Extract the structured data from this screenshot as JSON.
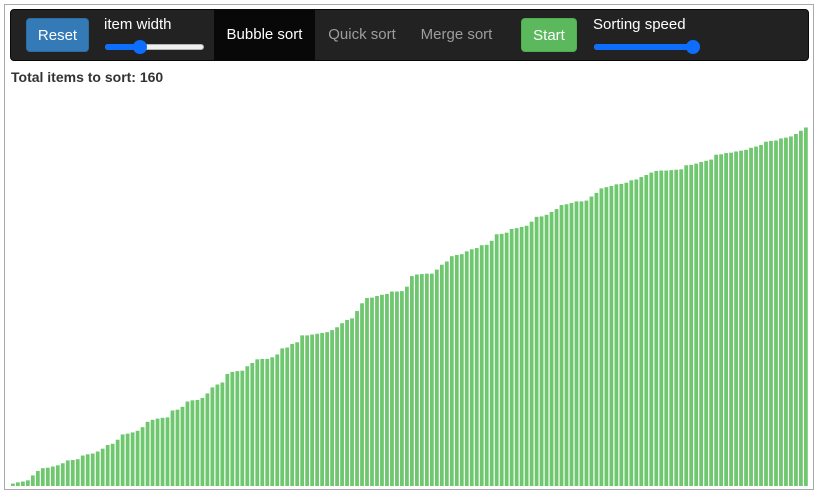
{
  "toolbar": {
    "reset_label": "Reset",
    "item_width_label": "item width",
    "item_width_value": 0.35,
    "tabs": [
      {
        "label": "Bubble sort",
        "active": true
      },
      {
        "label": "Quick sort",
        "active": false
      },
      {
        "label": "Merge sort",
        "active": false
      }
    ],
    "start_label": "Start",
    "speed_label": "Sorting speed",
    "speed_value": 1.0
  },
  "summary": {
    "label": "Total items to sort:",
    "count": "160"
  },
  "colors": {
    "navbar_bg": "#222222",
    "reset_button": "#337ab7",
    "start_button": "#5cb85c",
    "bar": "#6fc86f",
    "slider_accent": "#0d6efd"
  },
  "chart_data": {
    "type": "bar",
    "count": 160,
    "values": [
      0.6,
      0.9,
      1.1,
      1.4,
      2.6,
      3.7,
      4.4,
      4.5,
      4.8,
      5.1,
      5.6,
      6.3,
      6.4,
      6.6,
      7.5,
      7.8,
      8.0,
      8.5,
      9.2,
      10.1,
      10.4,
      11.4,
      12.7,
      12.9,
      13.2,
      13.6,
      14.5,
      15.8,
      16.3,
      16.6,
      16.8,
      16.9,
      18.6,
      18.8,
      19.5,
      20.8,
      21.1,
      21.2,
      21.7,
      22.8,
      24.3,
      25.0,
      25.5,
      27.6,
      28.1,
      28.3,
      28.4,
      29.5,
      30.3,
      31.2,
      31.3,
      31.3,
      31.7,
      32.4,
      33.9,
      34.1,
      35.0,
      35.4,
      37.1,
      37.1,
      37.3,
      37.5,
      37.7,
      37.9,
      38.4,
      39.1,
      40.1,
      40.9,
      41.3,
      43.1,
      45.0,
      46.3,
      46.4,
      46.8,
      47.1,
      47.3,
      47.9,
      47.9,
      48.0,
      49.1,
      51.7,
      52.1,
      52.2,
      52.3,
      52.3,
      53.3,
      54.5,
      55.3,
      56.6,
      56.9,
      57.1,
      57.8,
      58.3,
      58.6,
      59.3,
      59.4,
      60.4,
      62.0,
      62.1,
      62.4,
      63.3,
      63.5,
      63.8,
      64.1,
      65.1,
      66.3,
      66.4,
      66.8,
      67.5,
      68.2,
      69.2,
      69.4,
      69.7,
      70.1,
      70.1,
      70.3,
      71.3,
      72.2,
      73.3,
      73.6,
      73.9,
      74.3,
      74.4,
      74.7,
      75.3,
      75.5,
      76.1,
      76.6,
      77.2,
      77.6,
      77.7,
      77.7,
      77.8,
      77.9,
      78.0,
      79.0,
      79.1,
      79.4,
      79.8,
      80.1,
      80.4,
      81.6,
      81.7,
      82.0,
      82.1,
      82.4,
      82.6,
      82.8,
      83.3,
      83.6,
      84.0,
      84.8,
      85.0,
      85.1,
      85.6,
      85.8,
      86.1,
      86.7,
      87.5,
      88.3
    ],
    "ylim": [
      0,
      100
    ]
  }
}
